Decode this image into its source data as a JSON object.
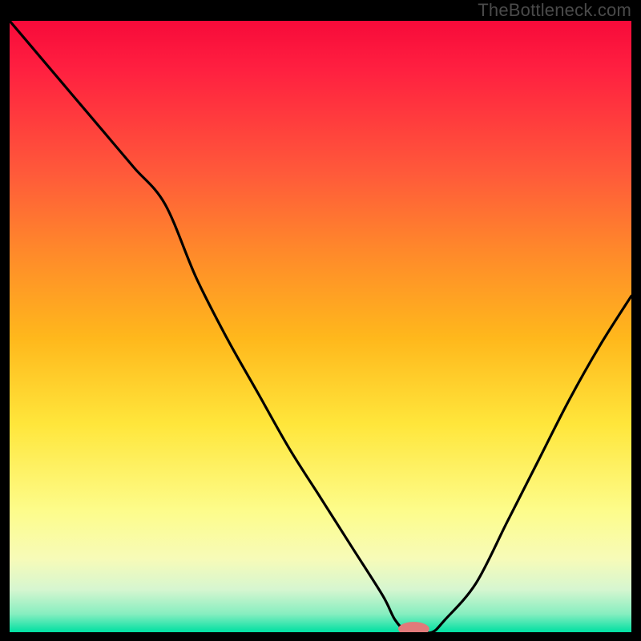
{
  "watermark": "TheBottleneck.com",
  "colors": {
    "black": "#000000",
    "gradient_stops": {
      "red_dark": "#f70a3a",
      "red": "#ff2040",
      "orange_r": "#ff5a3a",
      "orange": "#ff8a2a",
      "yellow_o": "#ffb81c",
      "yellow": "#ffe63b",
      "yellow_l": "#fdfc8a",
      "cream": "#f7fbb8",
      "pale": "#d6f6d0",
      "green_l": "#87eec0",
      "green": "#00e0a2"
    },
    "curve": "#000000",
    "marker_fill": "#e17a7a",
    "marker_stroke": "#b84f4f"
  },
  "chart_data": {
    "type": "line",
    "title": "",
    "xlabel": "",
    "ylabel": "",
    "xlim": [
      0,
      100
    ],
    "ylim": [
      0,
      100
    ],
    "x": [
      0,
      5,
      10,
      15,
      20,
      25,
      30,
      35,
      40,
      45,
      50,
      55,
      60,
      62,
      64,
      66,
      68,
      70,
      75,
      80,
      85,
      90,
      95,
      100
    ],
    "y": [
      100,
      94,
      88,
      82,
      76,
      70,
      58,
      48,
      39,
      30,
      22,
      14,
      6,
      2,
      0,
      0,
      0,
      2,
      8,
      18,
      28,
      38,
      47,
      55
    ],
    "marker": {
      "x": 65,
      "y": 0,
      "rx": 2.5,
      "ry": 0.9
    },
    "annotations": []
  }
}
